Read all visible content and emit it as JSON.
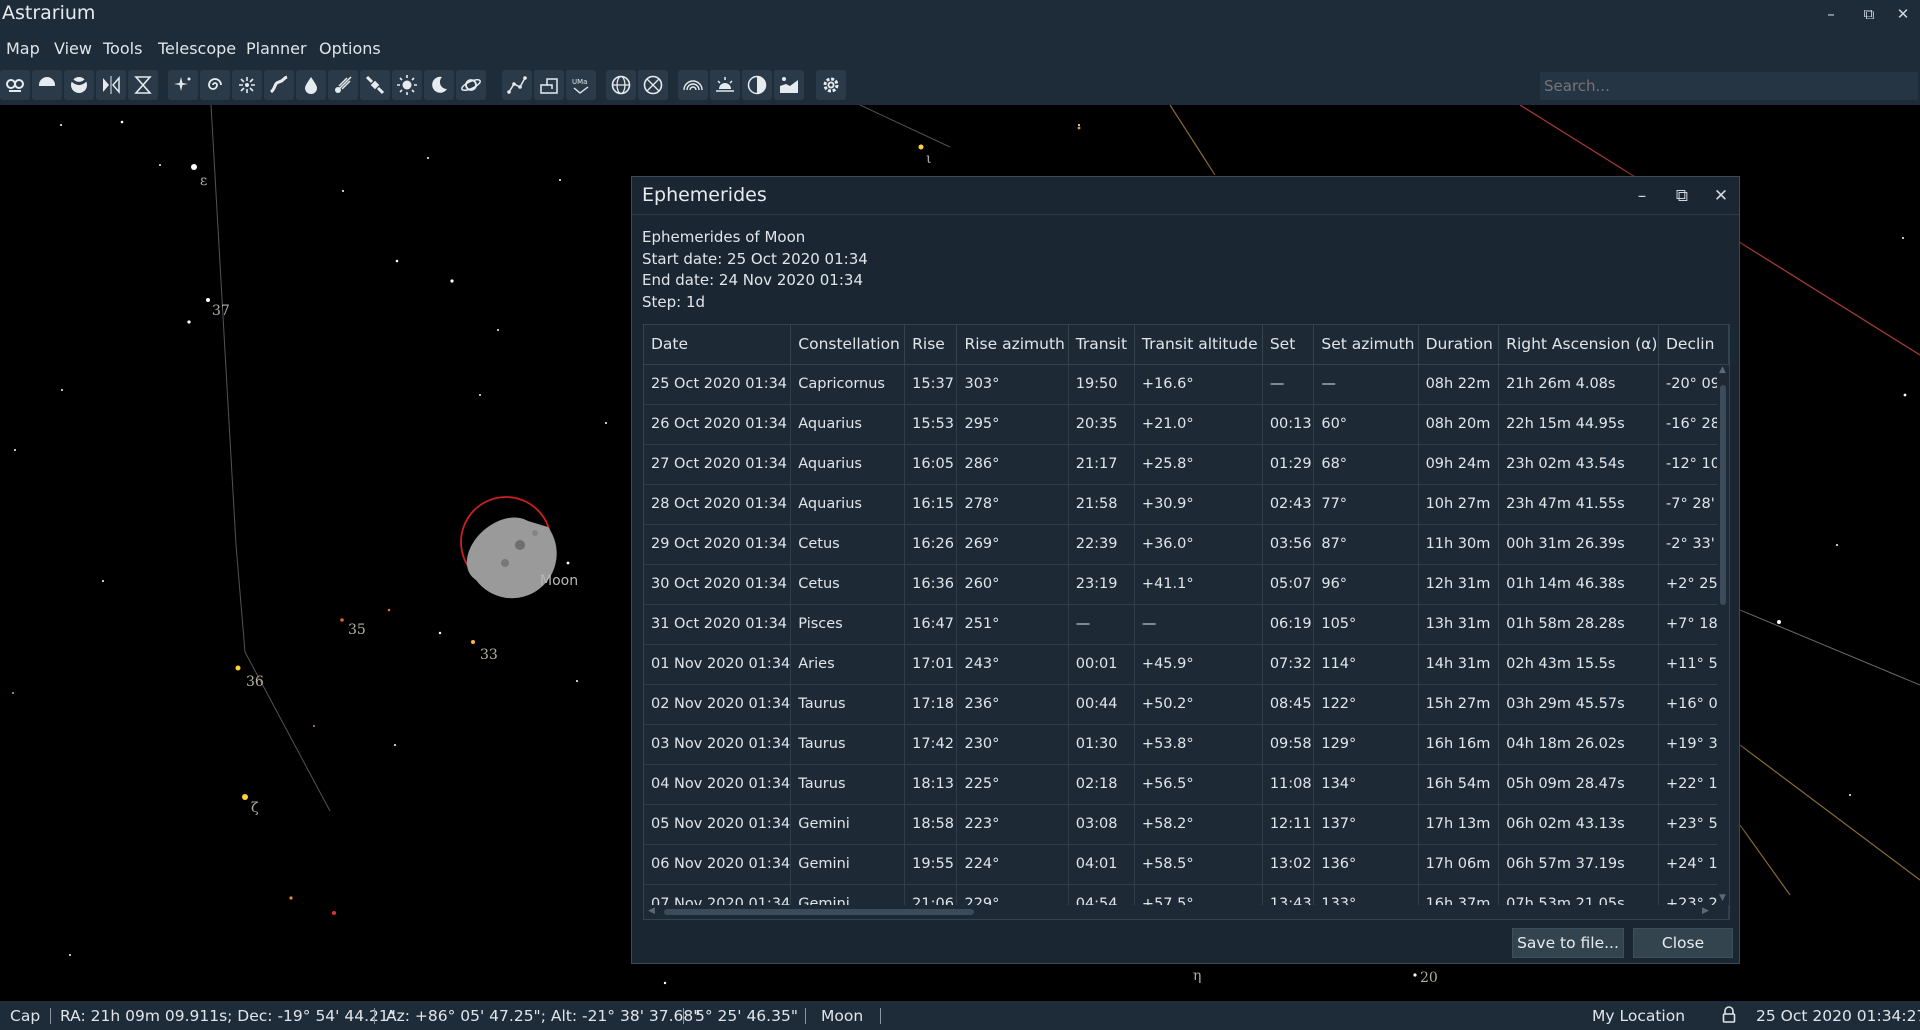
{
  "app": {
    "title": "Astrarium"
  },
  "window_controls": {
    "minimize": "–",
    "restore": "⧉",
    "close": "✕"
  },
  "menu": {
    "items": [
      "Map",
      "View",
      "Tools",
      "Telescope",
      "Planner",
      "Options"
    ]
  },
  "toolbar": {
    "buttons": [
      "owl-icon",
      "ground-icon",
      "horizon-icon",
      "mirror-icon",
      "hourglass-icon",
      "stars-icon",
      "galaxy-icon",
      "nebula-icon",
      "milky-way-icon",
      "drop-icon",
      "comet-icon",
      "satellite-icon",
      "sun-icon",
      "moon-icon",
      "planet-icon",
      "constellation-lines-icon",
      "constellation-borders-icon",
      "constellation-labels-icon",
      "equatorial-grid-icon",
      "ecliptic-grid-icon",
      "horizon-grid-icon",
      "sun-horizon-icon",
      "phases-icon",
      "landscape-icon",
      "settings-icon"
    ],
    "search_placeholder": "Search..."
  },
  "sky": {
    "labels": {
      "epsilon": "ε",
      "num37": "37",
      "num35": "35",
      "num33": "33",
      "num36": "36",
      "zeta": "ζ",
      "eta": "η",
      "num20": "20",
      "iota": "ι",
      "moon": "Moon"
    }
  },
  "dialog": {
    "title": "Ephemerides",
    "info": {
      "object": "Ephemerides of Moon",
      "start": "Start date: 25 Oct 2020 01:34",
      "end": "End date: 24 Nov 2020 01:34",
      "step": "Step: 1d"
    },
    "columns": [
      "Date",
      "Constellation",
      "Rise",
      "Rise azimuth",
      "Transit",
      "Transit altitude",
      "Set",
      "Set azimuth",
      "Duration",
      "Right Ascension (α)",
      "Declin"
    ],
    "rows": [
      [
        "25 Oct 2020 01:34",
        "Capricornus",
        "15:37",
        "303°",
        "19:50",
        "+16.6°",
        "—",
        "—",
        "08h 22m",
        "21h 26m 4.08s",
        "-20° 09"
      ],
      [
        "26 Oct 2020 01:34",
        "Aquarius",
        "15:53",
        "295°",
        "20:35",
        "+21.0°",
        "00:13",
        "60°",
        "08h 20m",
        "22h 15m 44.95s",
        "-16° 28"
      ],
      [
        "27 Oct 2020 01:34",
        "Aquarius",
        "16:05",
        "286°",
        "21:17",
        "+25.8°",
        "01:29",
        "68°",
        "09h 24m",
        "23h 02m 43.54s",
        "-12° 10"
      ],
      [
        "28 Oct 2020 01:34",
        "Aquarius",
        "16:15",
        "278°",
        "21:58",
        "+30.9°",
        "02:43",
        "77°",
        "10h 27m",
        "23h 47m 41.55s",
        "-7° 28'"
      ],
      [
        "29 Oct 2020 01:34",
        "Cetus",
        "16:26",
        "269°",
        "22:39",
        "+36.0°",
        "03:56",
        "87°",
        "11h 30m",
        "00h 31m 26.39s",
        "-2° 33'"
      ],
      [
        "30 Oct 2020 01:34",
        "Cetus",
        "16:36",
        "260°",
        "23:19",
        "+41.1°",
        "05:07",
        "96°",
        "12h 31m",
        "01h 14m 46.38s",
        "+2° 25"
      ],
      [
        "31 Oct 2020 01:34",
        "Pisces",
        "16:47",
        "251°",
        "—",
        "—",
        "06:19",
        "105°",
        "13h 31m",
        "01h 58m 28.28s",
        "+7° 18"
      ],
      [
        "01 Nov 2020 01:34",
        "Aries",
        "17:01",
        "243°",
        "00:01",
        "+45.9°",
        "07:32",
        "114°",
        "14h 31m",
        "02h 43m 15.5s",
        "+11° 5"
      ],
      [
        "02 Nov 2020 01:34",
        "Taurus",
        "17:18",
        "236°",
        "00:44",
        "+50.2°",
        "08:45",
        "122°",
        "15h 27m",
        "03h 29m 45.57s",
        "+16° 0"
      ],
      [
        "03 Nov 2020 01:34",
        "Taurus",
        "17:42",
        "230°",
        "01:30",
        "+53.8°",
        "09:58",
        "129°",
        "16h 16m",
        "04h 18m 26.02s",
        "+19° 3"
      ],
      [
        "04 Nov 2020 01:34",
        "Taurus",
        "18:13",
        "225°",
        "02:18",
        "+56.5°",
        "11:08",
        "134°",
        "16h 54m",
        "05h 09m 28.47s",
        "+22° 1"
      ],
      [
        "05 Nov 2020 01:34",
        "Gemini",
        "18:58",
        "223°",
        "03:08",
        "+58.2°",
        "12:11",
        "137°",
        "17h 13m",
        "06h 02m 43.13s",
        "+23° 5"
      ],
      [
        "06 Nov 2020 01:34",
        "Gemini",
        "19:55",
        "224°",
        "04:01",
        "+58.5°",
        "13:02",
        "136°",
        "17h 06m",
        "06h 57m 37.19s",
        "+24° 1"
      ],
      [
        "07 Nov 2020 01:34",
        "Gemini",
        "21:06",
        "229°",
        "04:54",
        "+57.5°",
        "13:43",
        "133°",
        "16h 37m",
        "07h 53m 21.05s",
        "+23° 2"
      ]
    ],
    "buttons": {
      "save": "Save to file...",
      "close": "Close"
    }
  },
  "status": {
    "constellation": "Cap",
    "equatorial": "RA: 21h 09m 09.911s; Dec: -19° 54' 44.21\"",
    "horizontal": "Az: +86° 05' 47.25\"; Alt: -21° 38' 37.68\"",
    "fov": "5° 25' 46.35\"",
    "object": "Moon",
    "location": "My Location",
    "datetime": "25 Oct 2020 01:34:27"
  },
  "colors": {
    "chrome": "#1e2b38",
    "dialog": "#1a2733",
    "moon_marker": "#cc1f1f",
    "line": "#6a5030"
  }
}
